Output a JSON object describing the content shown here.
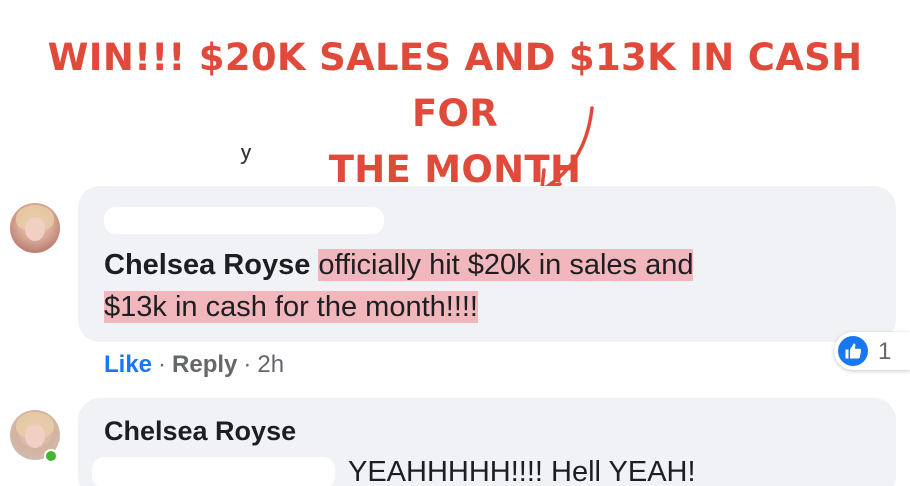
{
  "headline": {
    "line1": "WIN!!! $20K SALES AND $13K IN CASH FOR",
    "line2": "THE MONTH",
    "color": "#e04a3a"
  },
  "cut_text": "y",
  "comments": [
    {
      "author": "Chelsea Royse",
      "text_line1": "officially hit $20k in sales and",
      "text_line2": "$13k in cash for the month!!!!",
      "actions": {
        "like_label": "Like",
        "reply_label": "Reply",
        "separator": "·",
        "timestamp": "2h"
      },
      "reaction": {
        "icon": "thumbs-up-icon",
        "count": "1"
      }
    },
    {
      "author": "Chelsea Royse",
      "text": "YEAHHHHH!!!! Hell YEAH!",
      "online": true
    }
  ],
  "colors": {
    "highlight": "#f2b7bd",
    "like_blue": "#1877f2",
    "bubble_bg": "#f0f2f5",
    "online_green": "#42b72a"
  }
}
